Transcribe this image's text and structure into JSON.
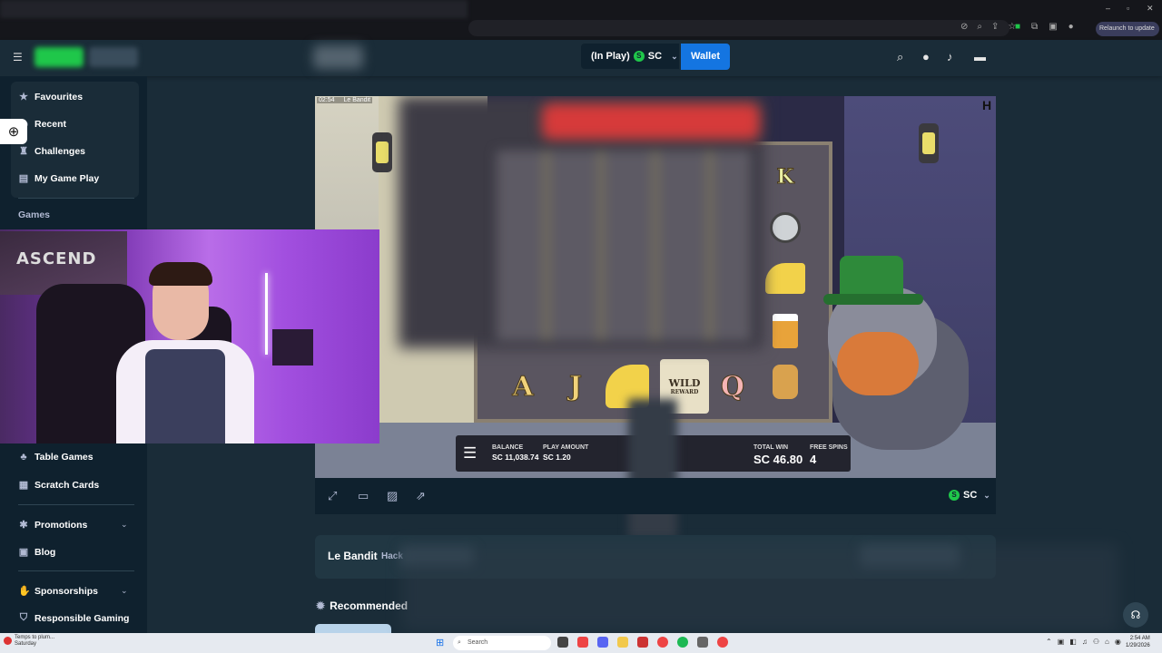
{
  "browser": {
    "relaunch_label": "Relaunch to update",
    "window_controls": [
      "–",
      "▫",
      "✕"
    ]
  },
  "header": {
    "currency_display": "(In Play)",
    "currency_code": "SC",
    "wallet_label": "Wallet",
    "sc_symbol": "S",
    "icons": [
      "search-icon",
      "user-icon",
      "bell-icon",
      "chat-icon"
    ]
  },
  "sidebar": {
    "top_items": [
      {
        "label": "Favourites",
        "icon": "star-icon"
      },
      {
        "label": "Recent",
        "icon": "clock-icon"
      },
      {
        "label": "Challenges",
        "icon": "trophy-icon"
      },
      {
        "label": "My Game Play",
        "icon": "list-icon"
      }
    ],
    "games_heading": "Games",
    "game_items": [
      {
        "label": "Table Games",
        "icon": "table-icon"
      },
      {
        "label": "Scratch Cards",
        "icon": "grid-icon"
      }
    ],
    "bottom_items": [
      {
        "label": "Promotions",
        "icon": "gift-icon",
        "expandable": true
      },
      {
        "label": "Blog",
        "icon": "document-icon",
        "expandable": false
      },
      {
        "label": "Sponsorships",
        "icon": "handshake-icon",
        "expandable": true
      },
      {
        "label": "Responsible Gaming",
        "icon": "shield-icon",
        "expandable": false
      }
    ]
  },
  "webcam": {
    "banner_text": "ASCEND"
  },
  "game": {
    "window_title": "Le Bandit",
    "window_time": "02:54",
    "bottom_row_symbols": [
      "A",
      "J",
      "cheese",
      "WILD",
      "Q"
    ],
    "right_column_symbols": [
      "K",
      "trap",
      "cheese",
      "beer",
      "bread"
    ],
    "balance_label": "BALANCE",
    "balance_value": "SC 11,038.74",
    "play_amount_label": "PLAY AMOUNT",
    "play_amount_value": "SC 1.20",
    "total_win_label": "TOTAL WIN",
    "total_win_value": "SC 46.80",
    "free_spins_label": "FREE SPINS",
    "free_spins_value": "4",
    "wild_label": "WILD",
    "wild_sub": "REWARD"
  },
  "frame_controls": {
    "icons": [
      "expand-icon",
      "theatre-icon",
      "stats-icon",
      "popout-icon"
    ],
    "currency_code": "SC"
  },
  "info_bar": {
    "game_title": "Le Bandit",
    "provider": "Hack"
  },
  "recommended": {
    "title": "Recommended"
  },
  "taskbar": {
    "weather_line1": "Temps to plum...",
    "weather_line2": "Saturday",
    "search_placeholder": "Search",
    "time": "2:54 AM",
    "date": "1/29/2026"
  }
}
